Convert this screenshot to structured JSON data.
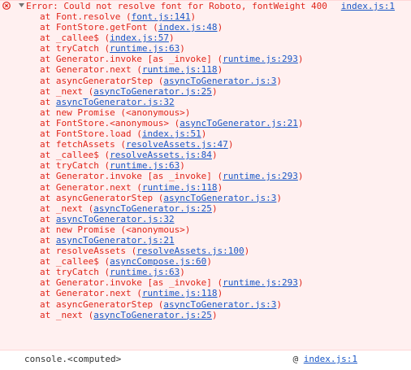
{
  "colors": {
    "error_text": "#e0261b",
    "link": "#1a57c6",
    "error_bg": "#fff0f0",
    "footer_text": "#333333"
  },
  "error": {
    "message": "Error: Could not resolve font for Roboto, fontWeight 400",
    "source": "index.js:1",
    "icon": "error-icon",
    "toggle_icon": "triangle-down-icon"
  },
  "stack": [
    {
      "prefix": "at Font.resolve (",
      "loc": "font.js:141",
      "suffix": ")"
    },
    {
      "prefix": "at FontStore.getFont (",
      "loc": "index.js:48",
      "suffix": ")"
    },
    {
      "prefix": "at _callee$ (",
      "loc": "index.js:57",
      "suffix": ")"
    },
    {
      "prefix": "at tryCatch (",
      "loc": "runtime.js:63",
      "suffix": ")"
    },
    {
      "prefix": "at Generator.invoke [as _invoke] (",
      "loc": "runtime.js:293",
      "suffix": ")"
    },
    {
      "prefix": "at Generator.next (",
      "loc": "runtime.js:118",
      "suffix": ")"
    },
    {
      "prefix": "at asyncGeneratorStep (",
      "loc": "asyncToGenerator.js:3",
      "suffix": ")"
    },
    {
      "prefix": "at _next (",
      "loc": "asyncToGenerator.js:25",
      "suffix": ")"
    },
    {
      "prefix": "at ",
      "loc": "asyncToGenerator.js:32",
      "suffix": ""
    },
    {
      "prefix": "at new Promise (<anonymous>)",
      "loc": "",
      "suffix": ""
    },
    {
      "prefix": "at FontStore.<anonymous> (",
      "loc": "asyncToGenerator.js:21",
      "suffix": ")"
    },
    {
      "prefix": "at FontStore.load (",
      "loc": "index.js:51",
      "suffix": ")"
    },
    {
      "prefix": "at fetchAssets (",
      "loc": "resolveAssets.js:47",
      "suffix": ")"
    },
    {
      "prefix": "at _callee$ (",
      "loc": "resolveAssets.js:84",
      "suffix": ")"
    },
    {
      "prefix": "at tryCatch (",
      "loc": "runtime.js:63",
      "suffix": ")"
    },
    {
      "prefix": "at Generator.invoke [as _invoke] (",
      "loc": "runtime.js:293",
      "suffix": ")"
    },
    {
      "prefix": "at Generator.next (",
      "loc": "runtime.js:118",
      "suffix": ")"
    },
    {
      "prefix": "at asyncGeneratorStep (",
      "loc": "asyncToGenerator.js:3",
      "suffix": ")"
    },
    {
      "prefix": "at _next (",
      "loc": "asyncToGenerator.js:25",
      "suffix": ")"
    },
    {
      "prefix": "at ",
      "loc": "asyncToGenerator.js:32",
      "suffix": ""
    },
    {
      "prefix": "at new Promise (<anonymous>)",
      "loc": "",
      "suffix": ""
    },
    {
      "prefix": "at ",
      "loc": "asyncToGenerator.js:21",
      "suffix": ""
    },
    {
      "prefix": "at resolveAssets (",
      "loc": "resolveAssets.js:100",
      "suffix": ")"
    },
    {
      "prefix": "at _callee$ (",
      "loc": "asyncCompose.js:60",
      "suffix": ")"
    },
    {
      "prefix": "at tryCatch (",
      "loc": "runtime.js:63",
      "suffix": ")"
    },
    {
      "prefix": "at Generator.invoke [as _invoke] (",
      "loc": "runtime.js:293",
      "suffix": ")"
    },
    {
      "prefix": "at Generator.next (",
      "loc": "runtime.js:118",
      "suffix": ")"
    },
    {
      "prefix": "at asyncGeneratorStep (",
      "loc": "asyncToGenerator.js:3",
      "suffix": ")"
    },
    {
      "prefix": "at _next (",
      "loc": "asyncToGenerator.js:25",
      "suffix": ")"
    }
  ],
  "footer": {
    "context": "console.<computed>",
    "at_sign": "@",
    "source": "index.js:1"
  }
}
